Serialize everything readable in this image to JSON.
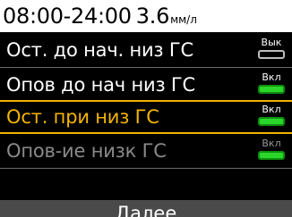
{
  "header": {
    "time_range": "08:00-24:00",
    "value": "3.6",
    "unit": "мм/л"
  },
  "settings": [
    {
      "label": "Ост. до нач. низ ГС",
      "state": "Вык",
      "on": false,
      "selected": false,
      "disabled": false
    },
    {
      "label": "Опов до нач низ ГС",
      "state": "Вкл",
      "on": true,
      "selected": false,
      "disabled": false
    },
    {
      "label": "Ост. при низ ГС",
      "state": "Вкл",
      "on": true,
      "selected": true,
      "disabled": false
    },
    {
      "label": "Опов-ие низк ГС",
      "state": "Вкл",
      "on": true,
      "selected": false,
      "disabled": true
    }
  ],
  "footer": {
    "next_label": "Далее"
  },
  "colors": {
    "selection": "#f2b400",
    "toggle_on": "#2bd62b",
    "disabled_text": "#8a8a8a"
  }
}
